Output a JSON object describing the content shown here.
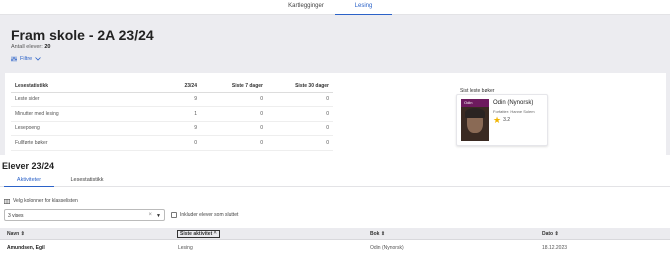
{
  "topnav": {
    "tabs": [
      {
        "label": "Kartlegginger",
        "active": false
      },
      {
        "label": "Lesing",
        "active": true
      }
    ]
  },
  "header": {
    "title": "Fram skole - 2A 23/24",
    "students_label": "Antall elever:",
    "students_count": "20",
    "filter_label": "Filtre"
  },
  "stats": {
    "headers": [
      "Lesestatistikk",
      "23/24",
      "Siste 7 dager",
      "Siste 30 dager"
    ],
    "rows": [
      {
        "label": "Leste sider",
        "year": "9",
        "d7": "0",
        "d30": "0"
      },
      {
        "label": "Minutter med lesing",
        "year": "1",
        "d7": "0",
        "d30": "0"
      },
      {
        "label": "Lesepoeng",
        "year": "9",
        "d7": "0",
        "d30": "0"
      },
      {
        "label": "Fullførte bøker",
        "year": "0",
        "d7": "0",
        "d30": "0"
      }
    ]
  },
  "recent": {
    "label": "Sist leste bøker",
    "book": {
      "cover_text": "Odin",
      "title": "Odin (Nynorsk)",
      "author": "Forfatter: Hanne Solem",
      "rating": "3.2"
    }
  },
  "students_section": {
    "title": "Elever 23/24",
    "tabs": [
      {
        "label": "Aktiviteter",
        "active": true
      },
      {
        "label": "Lesestatistikk",
        "active": false
      }
    ],
    "columns_link": "Velg kolonner for klasselisten",
    "select_value": "3 vises",
    "include_label": "Inkluder elever som sluttet",
    "grid_headers": [
      "Navn ⇕",
      "Siste aktivitet ^",
      "Bok ⇕",
      "Dato ⇕"
    ],
    "rows": [
      {
        "name": "Amundsen, Egil",
        "activity": "Lesing",
        "book": "Odin (Nynorsk)",
        "date": "18.12.2023"
      }
    ]
  },
  "colors": {
    "accent": "#2b62c8",
    "hero_bg": "#ececf0",
    "star": "#f0b400"
  }
}
